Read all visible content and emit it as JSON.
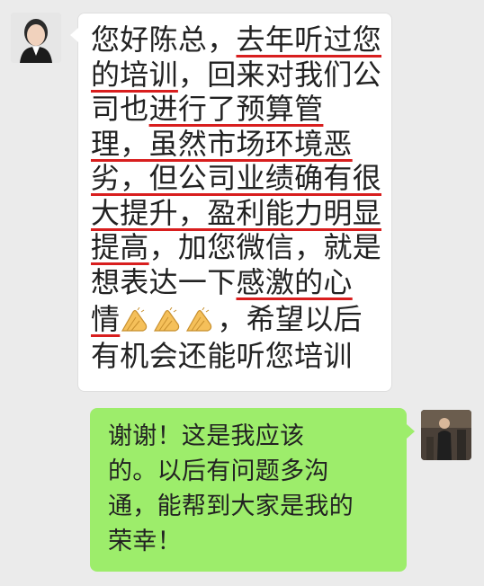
{
  "incoming": {
    "segments": [
      {
        "text": "您好陈总，",
        "u": false
      },
      {
        "text": "去年听过您",
        "u": true
      },
      {
        "text": "的培训",
        "u": true
      },
      {
        "text": "，回来对我们公",
        "u": false
      },
      {
        "text": "司也",
        "u": false
      },
      {
        "text": "进行了预算管",
        "u": true
      },
      {
        "text": "理，虽然市场环境恶",
        "u": true
      },
      {
        "text": "劣，但公司业绩确有很",
        "u": true
      },
      {
        "text": "大提升，盈利能力明显",
        "u": true
      },
      {
        "text": "提高",
        "u": true
      },
      {
        "text": "，加您微信，就是",
        "u": false
      },
      {
        "text": "想表达一下",
        "u": false
      },
      {
        "text": "感激的心",
        "u": true
      },
      {
        "text": "情",
        "u": true
      },
      {
        "text": "，希望以后",
        "u": false
      },
      {
        "text": "有机会还能听您培训",
        "u": false
      }
    ]
  },
  "outgoing": {
    "lines": [
      "谢谢！这是我应该",
      "的。以后有问题多沟",
      "通，能帮到大家是我的",
      "荣幸！"
    ]
  },
  "colors": {
    "background": "#ebebeb",
    "incoming_bubble": "#ffffff",
    "outgoing_bubble": "#9ded6b",
    "underline": "#d81e1e"
  },
  "icons": [
    "clap-emoji",
    "clap-emoji",
    "clap-emoji"
  ]
}
